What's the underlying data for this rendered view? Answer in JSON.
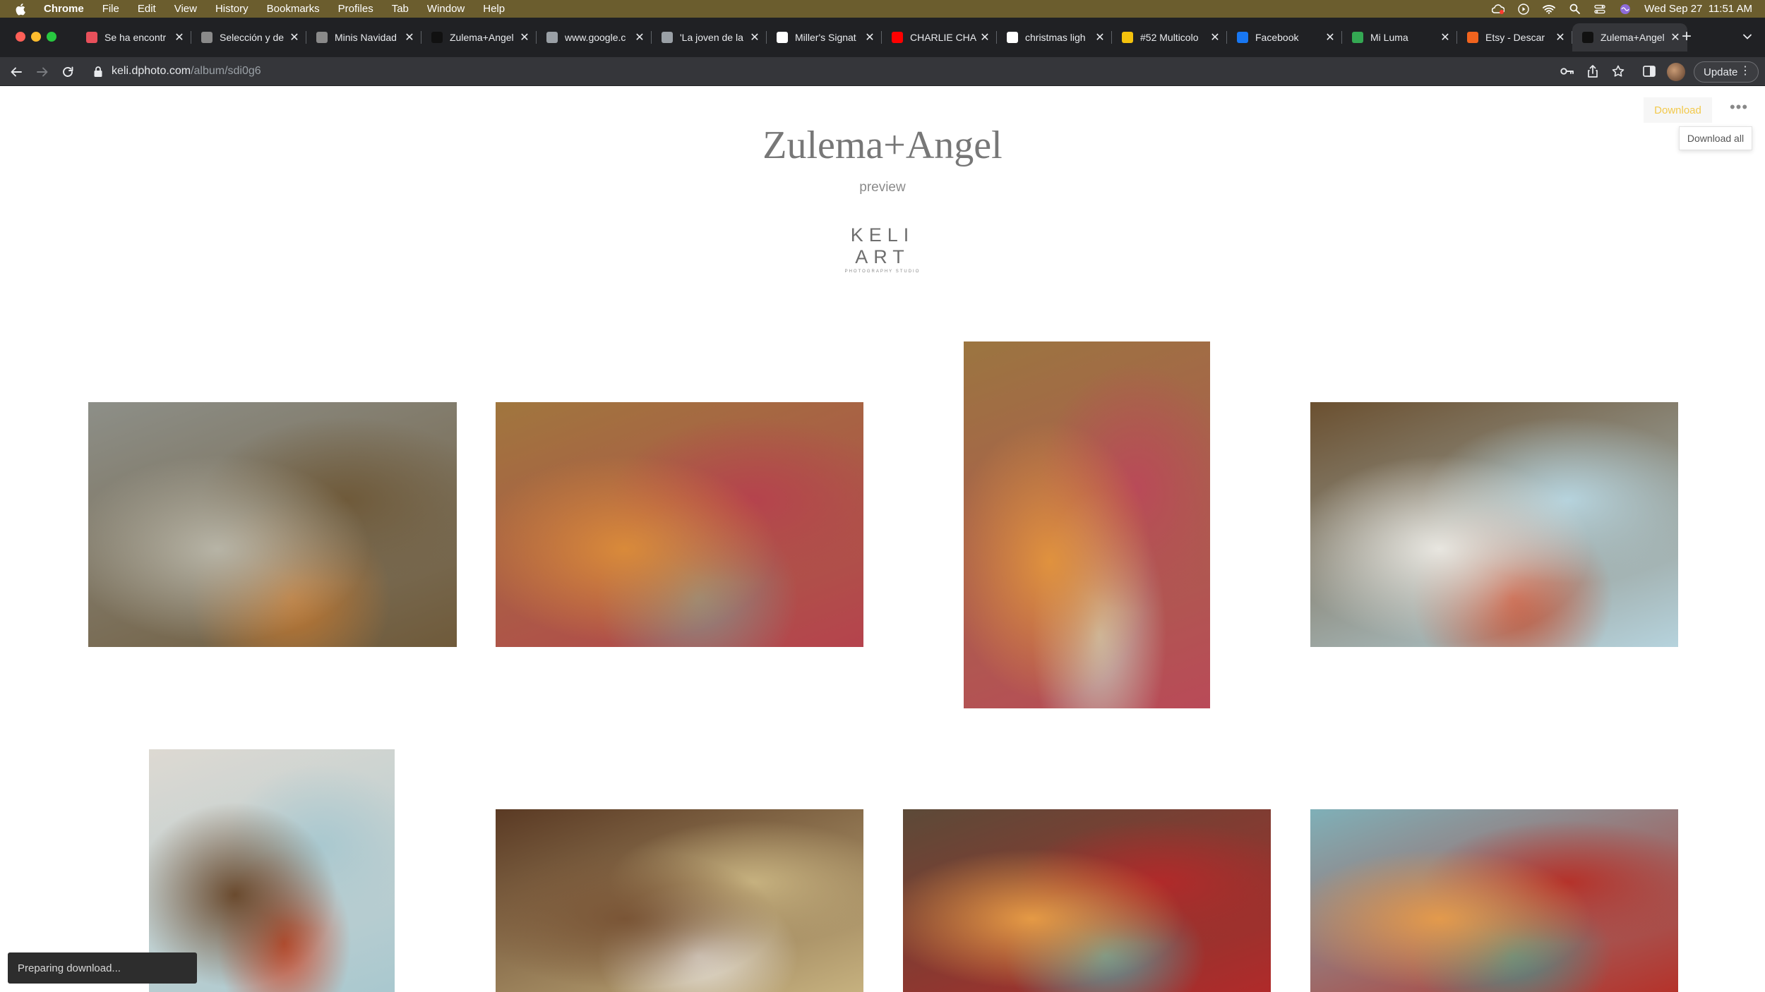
{
  "menubar": {
    "app_name": "Chrome",
    "items": [
      "File",
      "Edit",
      "View",
      "History",
      "Bookmarks",
      "Profiles",
      "Tab",
      "Window",
      "Help"
    ],
    "datetime": "Wed Sep 27  11:51 AM"
  },
  "tabs": [
    {
      "title": "Se ha encontr",
      "favicon_color": "#e8505b"
    },
    {
      "title": "Selección y de",
      "favicon_color": "#8a8a8a"
    },
    {
      "title": "Minis Navidad",
      "favicon_color": "#8a8a8a"
    },
    {
      "title": "Zulema+Angel",
      "favicon_color": "#111111"
    },
    {
      "title": "www.google.c",
      "favicon_color": "#9aa0a6"
    },
    {
      "title": "'La joven de la",
      "favicon_color": "#9aa0a6"
    },
    {
      "title": "Miller's Signat",
      "favicon_color": "#ffffff"
    },
    {
      "title": "CHARLIE CHA",
      "favicon_color": "#ff0000"
    },
    {
      "title": "christmas ligh",
      "favicon_color": "#ffffff"
    },
    {
      "title": "#52 Multicolo",
      "favicon_color": "#f4c20d"
    },
    {
      "title": "Facebook",
      "favicon_color": "#1877f2"
    },
    {
      "title": "Mi Luma",
      "favicon_color": "#34a853"
    },
    {
      "title": "Etsy - Descar",
      "favicon_color": "#f1641e"
    },
    {
      "title": "Zulema+Angel",
      "favicon_color": "#111111",
      "active": true
    }
  ],
  "toolbar": {
    "url_domain": "keli.dphoto.com",
    "url_path": "/album/sdi0g6",
    "update_label": "Update"
  },
  "page": {
    "title": "Zulema+Angel",
    "subtitle": "preview",
    "logo_text": "KELI ART",
    "logo_subtext": "PHOTOGRAPHY STUDIO",
    "download_label": "Download",
    "tooltip": "Download all",
    "toast": "Preparing download..."
  },
  "photos": [
    {
      "subject": "galvanized tray with wrapped favors",
      "palette": [
        "#8d8f88",
        "#b7b4a6",
        "#6f5a3a",
        "#c1772f"
      ]
    },
    {
      "subject": "tiered stand with oranges and dragon fruit",
      "palette": [
        "#a0763e",
        "#d98a3a",
        "#b5434d",
        "#8c8a84"
      ]
    },
    {
      "subject": "tiered stand with oranges close-up",
      "palette": [
        "#9b7540",
        "#e0923e",
        "#b94a58",
        "#c8c3b8"
      ]
    },
    {
      "subject": "decor display with screen and flowers",
      "palette": [
        "#6b5030",
        "#e8e6e0",
        "#b6d3dd",
        "#c44a2b"
      ]
    },
    {
      "subject": "decor display with pineapples",
      "palette": [
        "#ddd9d2",
        "#6a4a2e",
        "#a9c8cf",
        "#c94c2f"
      ]
    },
    {
      "subject": "plate with napkin and place card",
      "palette": [
        "#5a3a24",
        "#7a5536",
        "#c6b17f",
        "#e9e5de"
      ]
    },
    {
      "subject": "floral centerpiece with lilies and sunflowers",
      "palette": [
        "#5c4a38",
        "#e59a45",
        "#b02a2a",
        "#5e9a9c"
      ]
    },
    {
      "subject": "floral centerpiece with blue glasses",
      "palette": [
        "#7fb0b8",
        "#e39a4c",
        "#b5322a",
        "#4f8b86"
      ]
    }
  ]
}
